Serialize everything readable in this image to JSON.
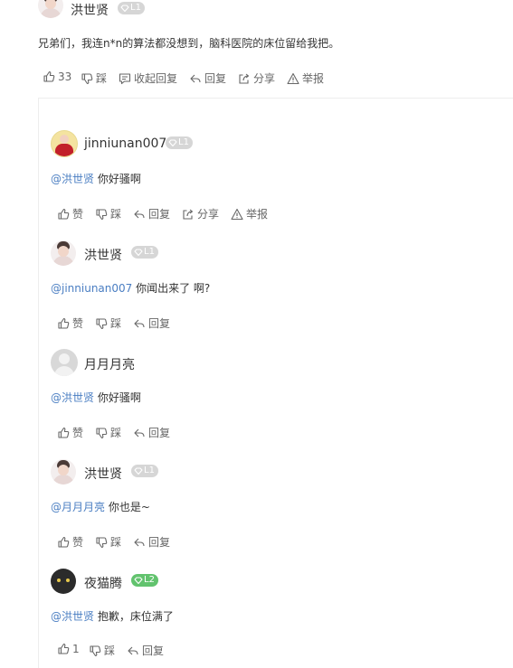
{
  "main_comment": {
    "username": "洪世贤",
    "level": "L1",
    "text": "兄弟们，我连n*n的算法都没想到，脑科医院的床位留给我把。",
    "like_count": "33",
    "actions": {
      "dislike": "踩",
      "collapse": "收起回复",
      "reply": "回复",
      "share": "分享",
      "report": "举报"
    }
  },
  "replies": [
    {
      "username": "jinniunan007",
      "level": "L1",
      "mention": "@洪世贤",
      "text": " 你好骚啊",
      "like": "赞",
      "dislike": "踩",
      "reply": "回复",
      "share": "分享",
      "report": "举报"
    },
    {
      "username": "洪世贤",
      "level": "L1",
      "mention": "@jinniunan007",
      "text": " 你闻出来了 啊?",
      "like": "赞",
      "dislike": "踩",
      "reply": "回复"
    },
    {
      "username": "月月月亮",
      "mention": "@洪世贤",
      "text": " 你好骚啊",
      "like": "赞",
      "dislike": "踩",
      "reply": "回复"
    },
    {
      "username": "洪世贤",
      "level": "L1",
      "mention": "@月月月亮",
      "text": " 你也是~",
      "like": "赞",
      "dislike": "踩",
      "reply": "回复"
    },
    {
      "username": "夜猫腾",
      "level": "L2",
      "mention": "@洪世贤",
      "text": " 抱歉，床位满了",
      "like": "1",
      "dislike": "踩",
      "reply": "回复"
    }
  ],
  "colors": {
    "mention": "#4a7ec2",
    "level_default": "#d6d6d6",
    "level_l2": "#62c36e"
  }
}
